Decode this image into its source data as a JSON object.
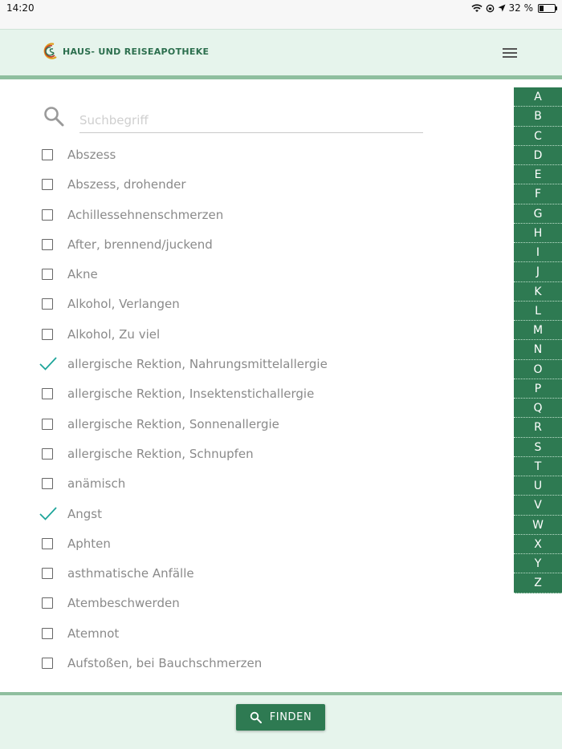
{
  "status": {
    "time": "14:20",
    "battery": "32 %",
    "battery_level": 0.32
  },
  "header": {
    "title": "HAUS- UND REISEAPOTHEKE"
  },
  "search": {
    "placeholder": "Suchbegriff",
    "value": ""
  },
  "items": [
    {
      "label": "Abszess",
      "checked": false
    },
    {
      "label": "Abszess, drohender",
      "checked": false
    },
    {
      "label": "Achillessehnenschmerzen",
      "checked": false
    },
    {
      "label": "After, brennend/juckend",
      "checked": false
    },
    {
      "label": "Akne",
      "checked": false
    },
    {
      "label": "Alkohol, Verlangen",
      "checked": false
    },
    {
      "label": "Alkohol, Zu viel",
      "checked": false
    },
    {
      "label": "allergische Rektion, Nahrungsmittelallergie",
      "checked": true
    },
    {
      "label": "allergische Rektion, Insektenstichallergie",
      "checked": false
    },
    {
      "label": "allergische Rektion, Sonnenallergie",
      "checked": false
    },
    {
      "label": "allergische Rektion, Schnupfen",
      "checked": false
    },
    {
      "label": "anämisch",
      "checked": false
    },
    {
      "label": "Angst",
      "checked": true
    },
    {
      "label": "Aphten",
      "checked": false
    },
    {
      "label": "asthmatische Anfälle",
      "checked": false
    },
    {
      "label": "Atembeschwerden",
      "checked": false
    },
    {
      "label": "Atemnot",
      "checked": false
    },
    {
      "label": "Aufstoßen, bei Bauchschmerzen",
      "checked": false
    }
  ],
  "alphabet": [
    "A",
    "B",
    "C",
    "D",
    "E",
    "F",
    "G",
    "H",
    "I",
    "J",
    "K",
    "L",
    "M",
    "N",
    "O",
    "P",
    "Q",
    "R",
    "S",
    "T",
    "U",
    "V",
    "W",
    "X",
    "Y",
    "Z"
  ],
  "footer": {
    "find_label": "FINDEN"
  },
  "colors": {
    "brand": "#2e7a52",
    "header_bg": "#e6f4ec",
    "check": "#1ea59a"
  }
}
